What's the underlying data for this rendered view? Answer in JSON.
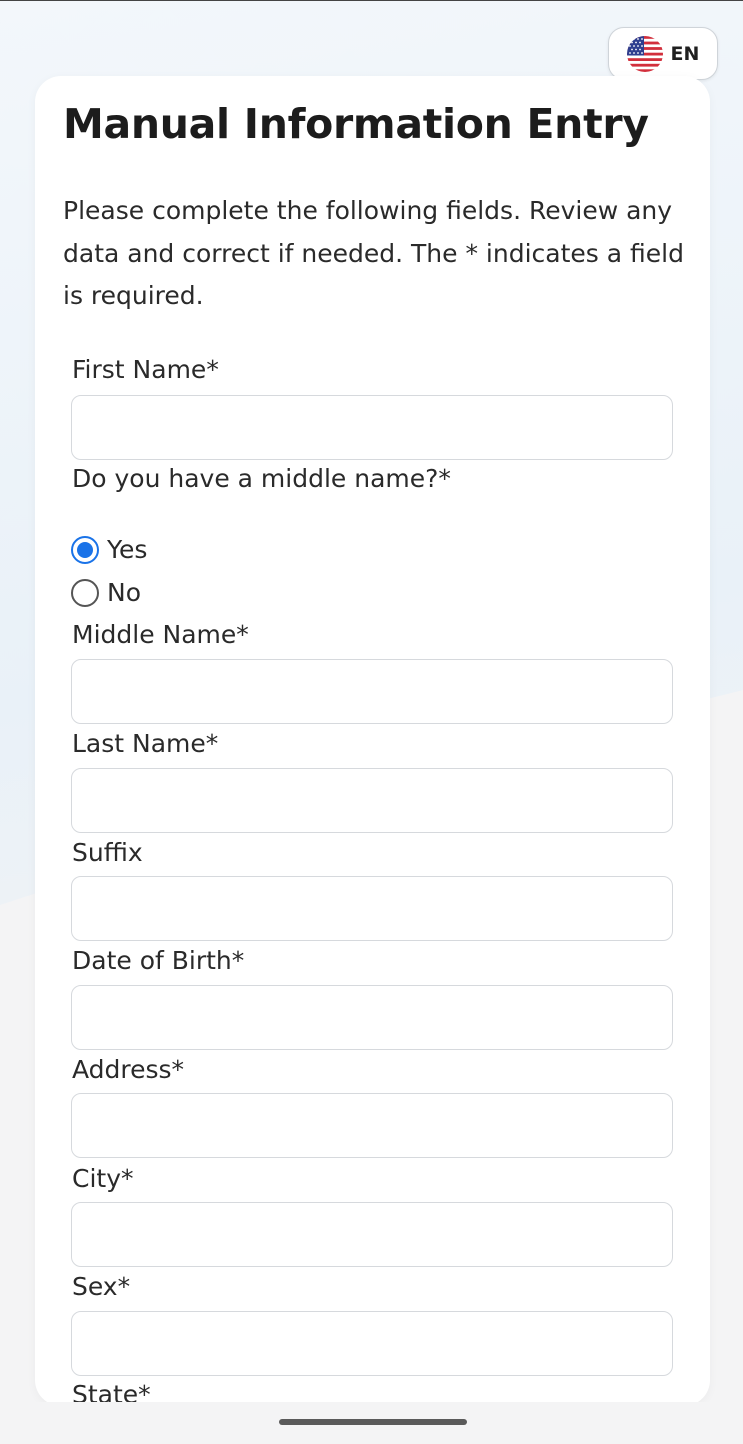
{
  "language": {
    "code": "EN",
    "flag_icon": "us-flag-icon"
  },
  "form": {
    "title": "Manual Information Entry",
    "intro": "Please complete the following fields. Review any data and correct if needed. The * indicates a field is required.",
    "first_name": {
      "label": "First Name*",
      "value": ""
    },
    "middle_name_question": {
      "label": "Do you have a middle name?*",
      "options": [
        {
          "label": "Yes",
          "selected": true
        },
        {
          "label": "No",
          "selected": false
        }
      ]
    },
    "middle_name": {
      "label": "Middle Name*",
      "value": ""
    },
    "last_name": {
      "label": "Last Name*",
      "value": ""
    },
    "suffix": {
      "label": "Suffix",
      "value": ""
    },
    "dob": {
      "label": "Date of Birth*",
      "value": ""
    },
    "address": {
      "label": "Address*",
      "value": ""
    },
    "city": {
      "label": "City*",
      "value": ""
    },
    "sex": {
      "label": "Sex*",
      "value": ""
    },
    "state": {
      "label": "State*"
    }
  },
  "colors": {
    "accent": "#1a73e8",
    "field_border": "#d6d9dd"
  }
}
